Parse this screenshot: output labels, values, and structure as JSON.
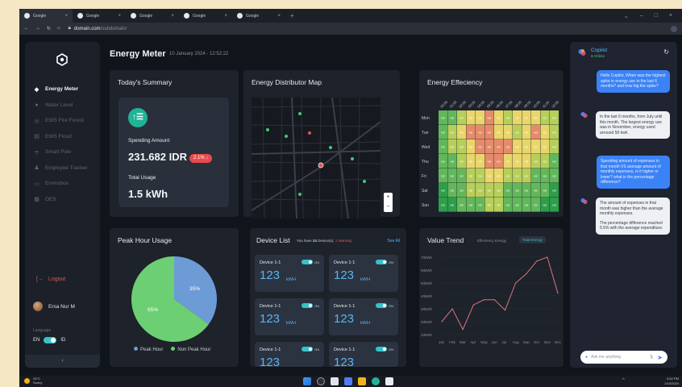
{
  "browser": {
    "tabs": [
      "Google",
      "Google",
      "Google",
      "Google",
      "Google"
    ],
    "url_domain": "domain.com",
    "url_path": "/subdomain/"
  },
  "sidebar": {
    "items": [
      {
        "label": "Energy Meter",
        "icon": "energy-icon"
      },
      {
        "label": "Water Level",
        "icon": "water-drop-icon"
      },
      {
        "label": "EWS Fire Forest",
        "icon": "fire-icon"
      },
      {
        "label": "EWS Flood",
        "icon": "flood-icon"
      },
      {
        "label": "Smart Pole",
        "icon": "pole-icon"
      },
      {
        "label": "Employee Tracker",
        "icon": "tracker-icon"
      },
      {
        "label": "Envirobox",
        "icon": "monitor-icon"
      },
      {
        "label": "OES",
        "icon": "grid-icon"
      }
    ],
    "logout": "Logout",
    "user_name": "Ersa Nur M",
    "language_label": "Language",
    "lang_en": "EN",
    "lang_id": "ID"
  },
  "header": {
    "title": "Energy Meter",
    "datetime": "10 January 2024 - 12:52:22"
  },
  "summary": {
    "title": "Today's Summary",
    "spending_label": "Spending Amount",
    "spending_value": "231.682 IDR",
    "change": "2.1% ↓",
    "usage_label": "Total Usage",
    "usage_value": "1.5 kWh"
  },
  "map": {
    "title": "Energy Distributor Map",
    "zoom_in": "+",
    "zoom_out": "−"
  },
  "efficiency": {
    "title": "Energy Effeciency"
  },
  "peak": {
    "title": "Peak Hour Usage",
    "legend_peak": "Peak Hour",
    "legend_nonpeak": "Non Peak Hour"
  },
  "devices": {
    "title": "Device List",
    "sub_prefix": "You have",
    "sub_count": "24",
    "sub_suffix": "Device(s),",
    "sub_warning": "1 Warning",
    "see_all": "See All",
    "items": [
      {
        "name": "Device 1-1",
        "status": "ON",
        "value": "123",
        "unit": "kWH"
      },
      {
        "name": "Device 1-1",
        "status": "ON",
        "value": "123",
        "unit": "kWH"
      },
      {
        "name": "Device 1-1",
        "status": "ON",
        "value": "123",
        "unit": "kWH"
      },
      {
        "name": "Device 1-1",
        "status": "ON",
        "value": "123",
        "unit": "kWH"
      },
      {
        "name": "Device 1-1",
        "status": "ON",
        "value": "123",
        "unit": ""
      },
      {
        "name": "Device 1-1",
        "status": "ON",
        "value": "123",
        "unit": ""
      }
    ]
  },
  "trend": {
    "title": "Value Trend",
    "tab_efficiency": "Effeciency Energy",
    "tab_total": "Total Energy"
  },
  "copilot": {
    "title": "Copilot",
    "status": "Online",
    "messages": [
      {
        "role": "user",
        "text": "Hello Copilot, When was the highest spike in energy use in the last 6 months? and how big the spike?"
      },
      {
        "role": "assistant",
        "text": "In the last 6 months, from July until this month. The largest energy use was in November, energy used arround 58 kwh."
      },
      {
        "role": "user",
        "text": "Spending amount of expenses in that month VS average amount of monthly expenses, is it higher or lower? what is the percentage difference?"
      },
      {
        "role": "assistant",
        "text": "The amount of expenses in that month was higher than the average monthly expenses."
      },
      {
        "role": "assistant",
        "text": "The percentage difference reached 5.5% with the average expenditure."
      }
    ],
    "placeholder": "Ask me anything"
  },
  "taskbar": {
    "temp": "24°C",
    "weather": "Sunny",
    "time": "0:52 PM",
    "date": "1/10/2024"
  },
  "chart_data": [
    {
      "type": "heatmap",
      "title": "Energy Effeciency",
      "x": [
        "00:00",
        "01:00",
        "02:00",
        "03:00",
        "04:00",
        "05:00",
        "06:00",
        "07:00",
        "08:00",
        "09:00",
        "10:00",
        "11:00",
        "12:00"
      ],
      "y": [
        "Mon",
        "Tue",
        "Wed",
        "Thu",
        "Fri",
        "Sat",
        "Sun"
      ],
      "cell_label": "val",
      "levels": [
        [
          1,
          1,
          2,
          3,
          3,
          4,
          3,
          2,
          3,
          3,
          3,
          2,
          2
        ],
        [
          1,
          2,
          3,
          4,
          4,
          4,
          3,
          3,
          2,
          3,
          4,
          3,
          2
        ],
        [
          1,
          2,
          2,
          3,
          4,
          4,
          4,
          4,
          3,
          3,
          3,
          3,
          2
        ],
        [
          1,
          1,
          2,
          3,
          3,
          4,
          4,
          3,
          3,
          3,
          2,
          2,
          1
        ],
        [
          1,
          1,
          1,
          2,
          2,
          3,
          3,
          2,
          2,
          2,
          1,
          1,
          1
        ],
        [
          0,
          1,
          1,
          2,
          2,
          2,
          2,
          1,
          1,
          1,
          1,
          1,
          0
        ],
        [
          0,
          0,
          1,
          1,
          1,
          2,
          2,
          1,
          1,
          1,
          1,
          0,
          0
        ]
      ],
      "colors": [
        "#2e9e4a",
        "#63b75b",
        "#b6cf5a",
        "#e9d66a",
        "#e58b6b"
      ]
    },
    {
      "type": "pie",
      "title": "Peak Hour Usage",
      "labels": [
        "Peak Hour",
        "Non Peak Hour"
      ],
      "values": [
        35,
        65
      ],
      "value_labels": [
        "35%",
        "65%"
      ],
      "colors": [
        "#6d9bd6",
        "#6dcf73"
      ]
    },
    {
      "type": "line",
      "title": "Value Trend",
      "categories": [
        "Jan",
        "Feb",
        "Mar",
        "Apr",
        "May",
        "Jun",
        "Jul",
        "Aug",
        "Sep",
        "Oct",
        "Nov",
        "Dec"
      ],
      "values": [
        20,
        30,
        14,
        33,
        37,
        37,
        29,
        50,
        57,
        67,
        70,
        42
      ],
      "yticks": [
        "10kWh",
        "20kWh",
        "30kWh",
        "40kWh",
        "50kWh",
        "60kWh",
        "70kWh"
      ],
      "ylim": [
        10,
        70
      ],
      "color": "#d9757a"
    }
  ]
}
